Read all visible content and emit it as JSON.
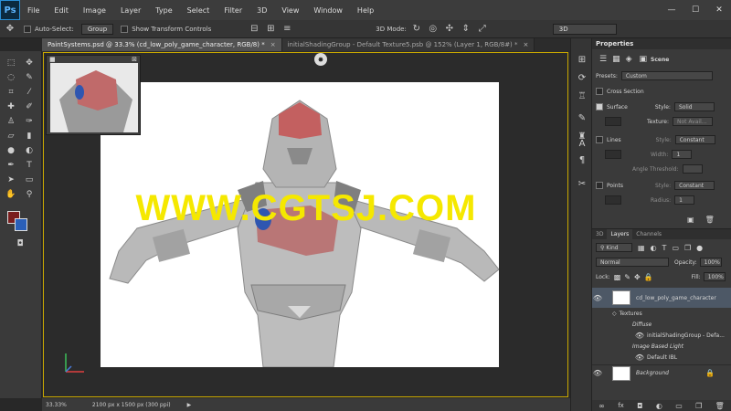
{
  "menubar": {
    "logo": "Ps",
    "items": [
      "File",
      "Edit",
      "Image",
      "Layer",
      "Type",
      "Select",
      "Filter",
      "3D",
      "View",
      "Window",
      "Help"
    ]
  },
  "optionsbar": {
    "auto_select_label": "Auto-Select:",
    "auto_select_value": "Group",
    "transform_label": "Show Transform Controls",
    "mode_label": "3D Mode:",
    "workspace_value": "3D"
  },
  "tabs": [
    {
      "label": "PaintSystems.psd @ 33.3% (cd_low_poly_game_character, RGB/8) *",
      "active": true
    },
    {
      "label": "initialShadingGroup - Default Texture5.psb @ 152% (Layer 1, RGB/8#) *",
      "active": false
    }
  ],
  "canvas": {
    "watermark": "WWW.CGTSJ.COM"
  },
  "statusbar": {
    "zoom": "33.33%",
    "info": "2100 px x 1500 px (300 ppi)"
  },
  "properties": {
    "title": "Properties",
    "scene_label": "Scene",
    "presets_label": "Presets:",
    "presets_value": "Custom",
    "cross_section": "Cross Section",
    "surface": "Surface",
    "style_label": "Style:",
    "surface_style": "Solid",
    "texture_label": "Texture:",
    "texture_value": "Not Avail...",
    "lines": "Lines",
    "lines_style": "Constant",
    "width_label": "Width:",
    "width_value": "1",
    "angle_label": "Angle Threshold:",
    "points": "Points",
    "points_style": "Constant",
    "radius_label": "Radius:",
    "radius_value": "1"
  },
  "layers": {
    "tabs": [
      "3D",
      "Layers",
      "Channels"
    ],
    "kind_label": "Kind",
    "blend_mode": "Normal",
    "opacity_label": "Opacity:",
    "opacity_value": "100%",
    "lock_label": "Lock:",
    "fill_label": "Fill:",
    "fill_value": "100%",
    "items": {
      "character": "cd_low_poly_game_character",
      "textures": "Textures",
      "diffuse": "Diffuse",
      "shading_group": "initialShadingGroup - Defa...",
      "ibl": "Image Based Light",
      "default_ibl": "Default IBL",
      "background": "Background"
    }
  },
  "colors": {
    "foreground": "#7a1e1e",
    "background": "#2a5fb8",
    "watermark": "#f5e800"
  }
}
